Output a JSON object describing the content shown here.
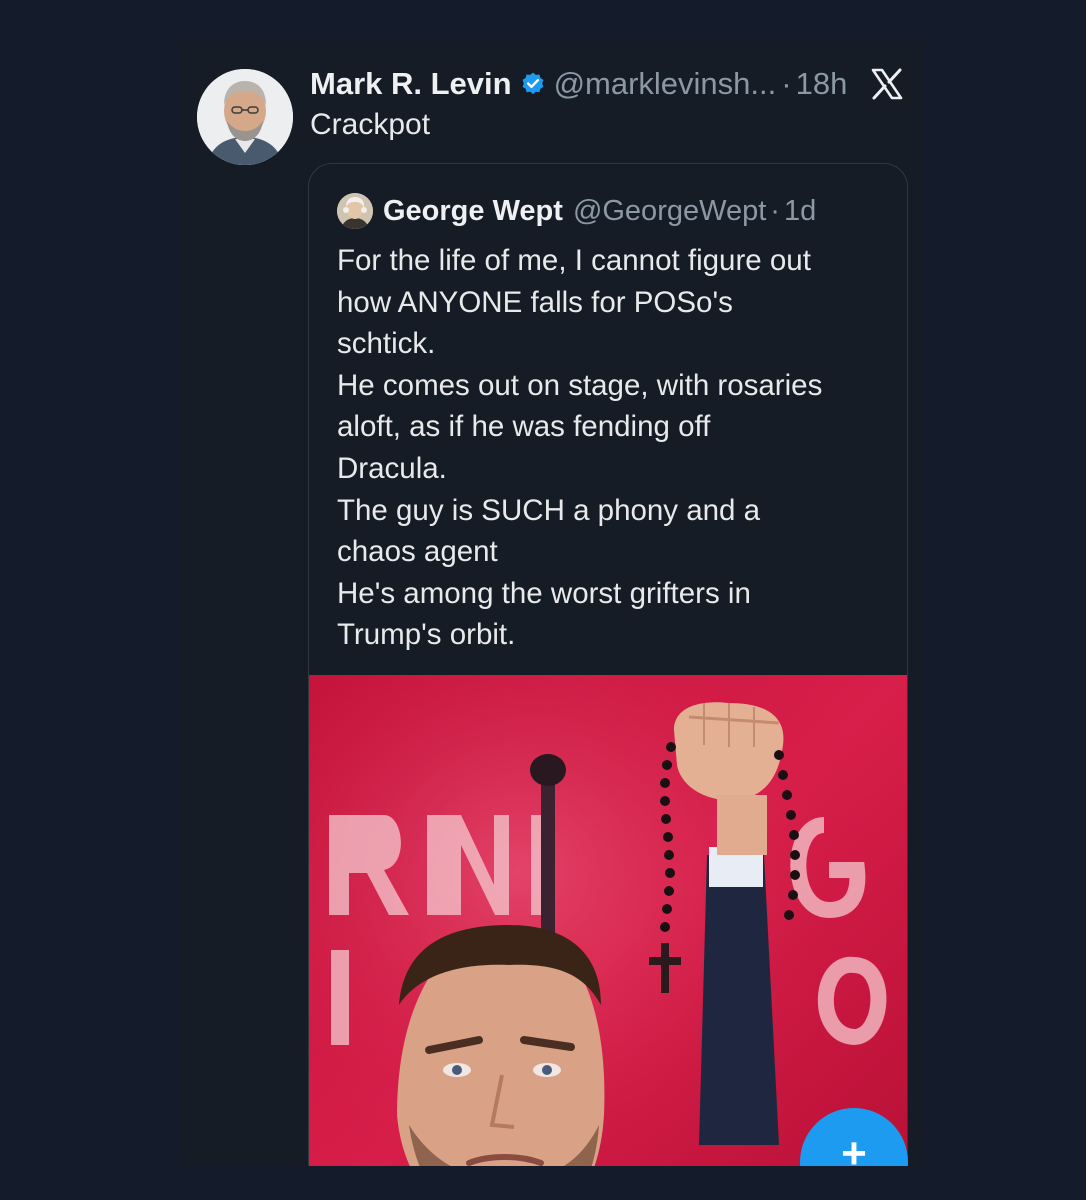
{
  "post": {
    "author_name": "Mark R. Levin",
    "handle": "@marklevinsh...",
    "separator": "·",
    "time": "18h",
    "text": "Crackpot",
    "platform_icon": "x-logo-icon",
    "verified_icon": "verified-badge-icon",
    "verified_color": "#1d9bf0"
  },
  "quote": {
    "author_name": "George Wept",
    "handle": "@GeorgeWept",
    "separator": "·",
    "time": "1d",
    "lines": [
      "For the life of me, I cannot figure out",
      "how ANYONE falls for POSo's",
      "schtick.",
      "He comes out on stage, with rosaries",
      "aloft, as if he was fending off",
      "Dracula.",
      "The guy is SUCH a phony and a",
      "chaos agent",
      "He's among the worst grifters in",
      "Trump's orbit."
    ],
    "media_icon": "photo-man-holding-rosary"
  },
  "compose_button": {
    "label": "+",
    "color": "#1d9bf0"
  }
}
